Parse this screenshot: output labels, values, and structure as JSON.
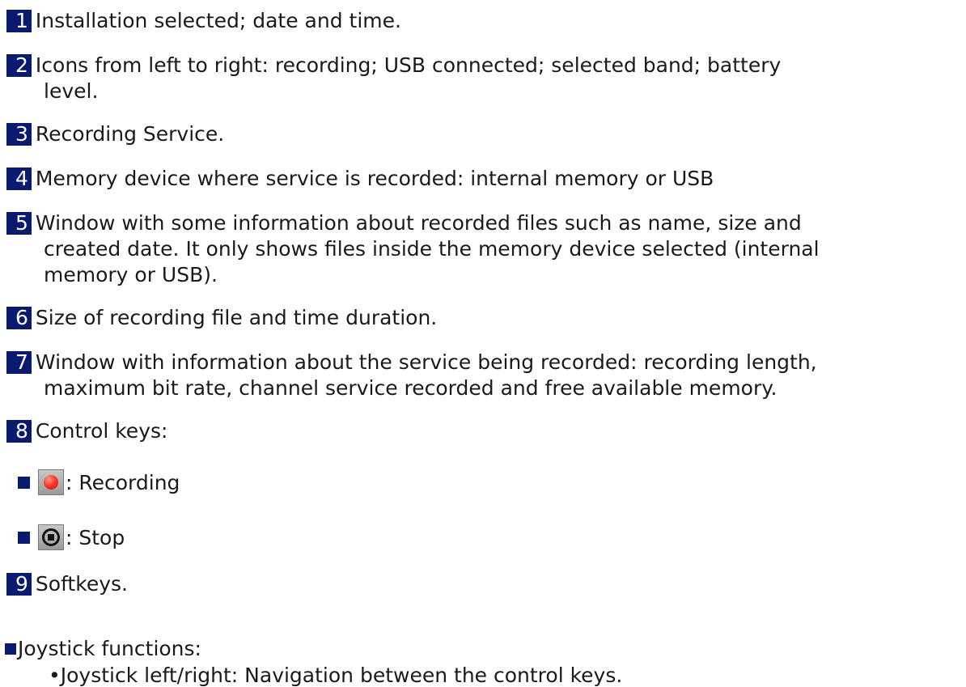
{
  "items": [
    {
      "num": "1",
      "text": "Installation selected; date and time."
    },
    {
      "num": "2",
      "text": "Icons from left to right: recording; USB connected; selected band; battery",
      "cont": [
        "level."
      ]
    },
    {
      "num": "3",
      "text": "Recording Service."
    },
    {
      "num": "4",
      "text": "Memory device where service is recorded: internal memory or USB"
    },
    {
      "num": "5",
      "text": "Window with some information about recorded files such as name, size and",
      "cont": [
        "created date. It only shows files inside the memory device selected (internal",
        "memory or USB)."
      ]
    },
    {
      "num": "6",
      "text": "Size of recording file and time duration."
    },
    {
      "num": "7",
      "text": "Window with information about the service being recorded: recording length,",
      "cont": [
        "maximum bit rate, channel service recorded and free available memory."
      ]
    },
    {
      "num": "8",
      "text": "Control keys:"
    },
    {
      "num": "9",
      "text": "Softkeys."
    }
  ],
  "control_keys": [
    {
      "icon": "record-icon",
      "label": ": Recording"
    },
    {
      "icon": "stop-icon",
      "label": ": Stop"
    }
  ],
  "joystick": {
    "title": "Joystick functions:",
    "items": [
      "•Joystick left/right: Navigation between the control keys."
    ]
  }
}
